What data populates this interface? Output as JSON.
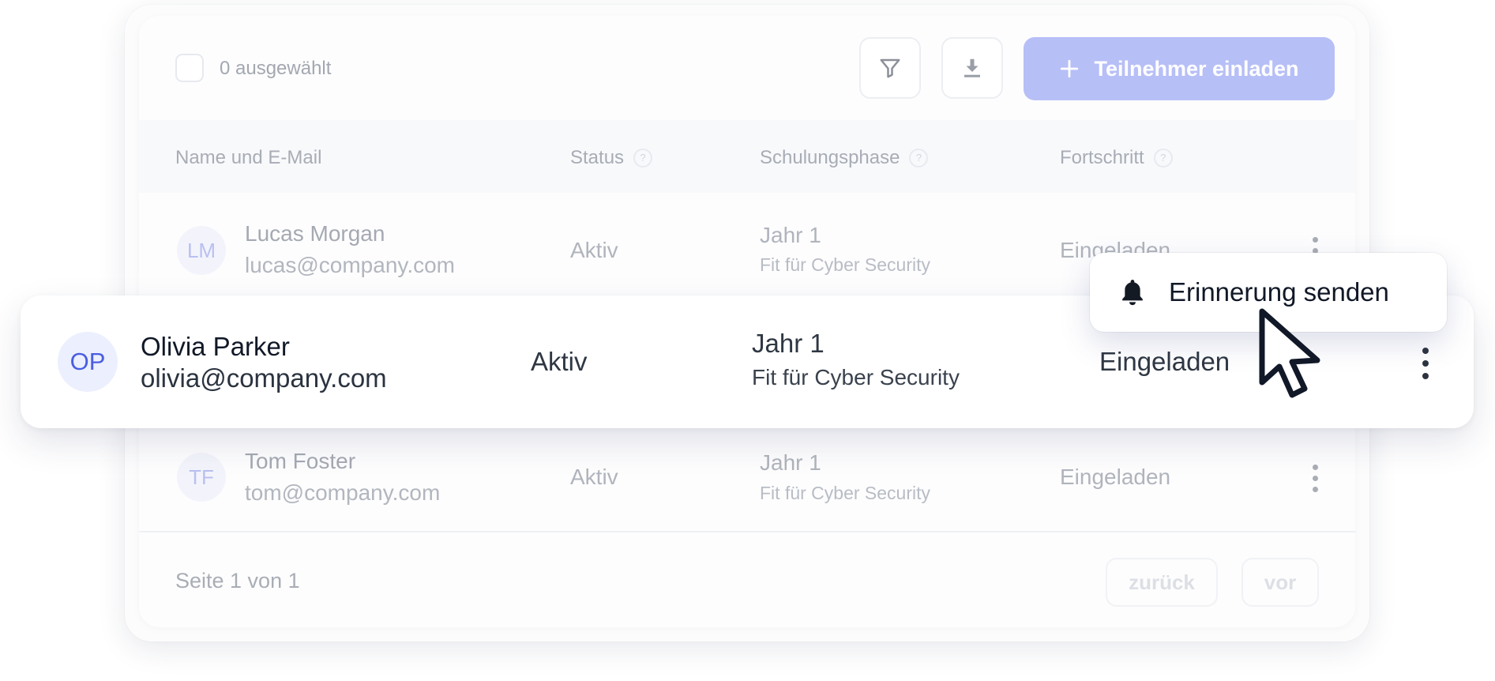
{
  "toolbar": {
    "selected_count": "0 ausgewählt",
    "filter_icon": "filter-icon",
    "download_icon": "download-icon",
    "invite_label": "Teilnehmer einladen",
    "invite_icon": "plus-icon"
  },
  "table": {
    "headers": [
      {
        "label": "Name und E-Mail",
        "help": false
      },
      {
        "label": "Status",
        "help": true
      },
      {
        "label": "Schulungsphase",
        "help": true
      },
      {
        "label": "Fortschritt",
        "help": true
      }
    ],
    "rows": [
      {
        "initials": "LM",
        "name": "Lucas Morgan",
        "email": "lucas@company.com",
        "status": "Aktiv",
        "phase": "Jahr 1",
        "phase_sub": "Fit für Cyber Security",
        "progress": "Eingeladen"
      },
      {
        "initials": "OP",
        "name": "Olivia Parker",
        "email": "olivia@company.com",
        "status": "Aktiv",
        "phase": "Jahr 1",
        "phase_sub": "Fit für Cyber Security",
        "progress": "Eingeladen"
      },
      {
        "initials": "TF",
        "name": "Tom Foster",
        "email": "tom@company.com",
        "status": "Aktiv",
        "phase": "Jahr 1",
        "phase_sub": "Fit für Cyber Security",
        "progress": "Eingeladen"
      }
    ]
  },
  "popup": {
    "icon": "bell-icon",
    "label": "Erinnerung senden"
  },
  "pagination": {
    "text": "Seite 1 von 1",
    "prev_label": "zurück",
    "next_label": "vor"
  },
  "colors": {
    "accent": "#b7bff7",
    "avatar_text": "#4a5ee0"
  }
}
